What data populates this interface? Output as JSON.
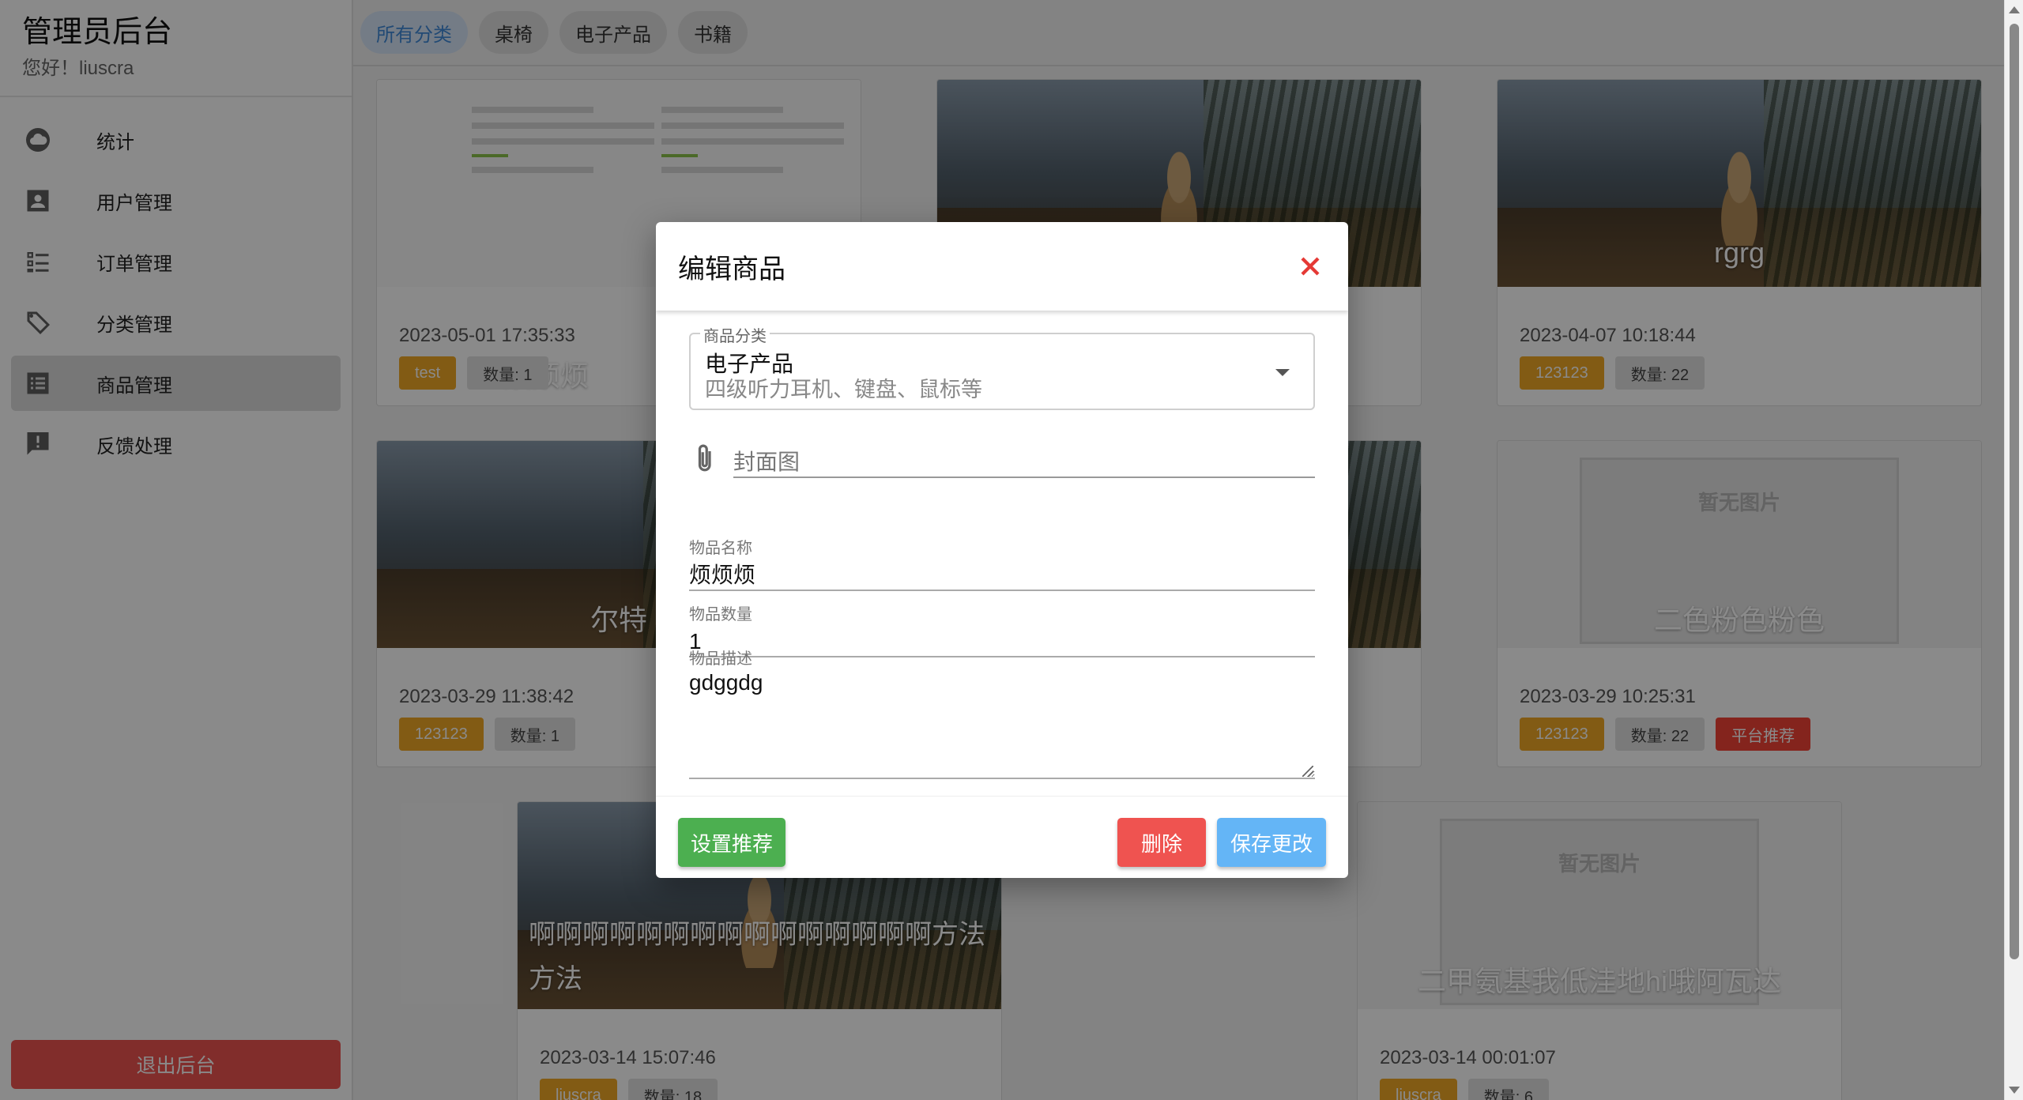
{
  "sidebar": {
    "title": "管理员后台",
    "greeting": "您好！liuscra",
    "items": [
      {
        "label": "统计"
      },
      {
        "label": "用户管理"
      },
      {
        "label": "订单管理"
      },
      {
        "label": "分类管理"
      },
      {
        "label": "商品管理"
      },
      {
        "label": "反馈处理"
      }
    ],
    "active_index": 4,
    "logout_label": "退出后台"
  },
  "chips": [
    {
      "label": "所有分类"
    },
    {
      "label": "桌椅"
    },
    {
      "label": "电子产品"
    },
    {
      "label": "书籍"
    }
  ],
  "products": [
    {
      "name": "烦烦烦",
      "date": "2023-05-01 17:35:33",
      "category": "test",
      "qty": "数量: 1",
      "image": "screenshot"
    },
    {
      "name": "",
      "date": "",
      "category": "",
      "qty": "",
      "image": "cat"
    },
    {
      "name": "rgrg",
      "date": "2023-04-07 10:18:44",
      "category": "123123",
      "qty": "数量: 22",
      "image": "cat"
    },
    {
      "name": "尔特",
      "date": "2023-03-29 11:38:42",
      "category": "123123",
      "qty": "数量: 1",
      "image": "cat"
    },
    {
      "name": "",
      "date": "",
      "category": "",
      "qty": "",
      "image": "cat"
    },
    {
      "name": "二色粉色粉色",
      "date": "2023-03-29 10:25:31",
      "category": "123123",
      "qty": "数量: 22",
      "badge": "平台推荐",
      "image": "none"
    },
    {
      "name": "啊啊啊啊啊啊啊啊啊啊啊啊啊啊啊方法方法",
      "date": "2023-03-14 15:07:46",
      "category": "liuscra",
      "qty": "数量: 18",
      "image": "cat"
    },
    {
      "name": "二甲氨基我低洼地hi哦阿瓦达",
      "date": "2023-03-14 00:01:07",
      "category": "liuscra",
      "qty": "数量: 6",
      "image": "none"
    }
  ],
  "no_image_text": "暂无图片",
  "dialog": {
    "title": "编辑商品",
    "category_legend": "商品分类",
    "category_value": "电子产品",
    "category_hint": "四级听力耳机、键盘、鼠标等",
    "cover_label": "封面图",
    "name_label": "物品名称",
    "name_value": "烦烦烦",
    "qty_label": "物品数量",
    "qty_value": "1",
    "desc_label": "物品描述",
    "desc_value": "gdggdg",
    "recommend_label": "设置推荐",
    "delete_label": "删除",
    "save_label": "保存更改"
  },
  "colors": {
    "accent": "#3f8ad8",
    "danger": "#ef5350",
    "success": "#4caf50",
    "primary": "#64b5f6",
    "tag_category": "#f0a825",
    "tag_recommend": "#f44336"
  },
  "icons": [
    "cloud-icon",
    "account-box-icon",
    "list-check-icon",
    "tag-icon",
    "list-box-icon",
    "feedback-icon",
    "close-icon",
    "paperclip-icon",
    "dropdown-icon"
  ]
}
